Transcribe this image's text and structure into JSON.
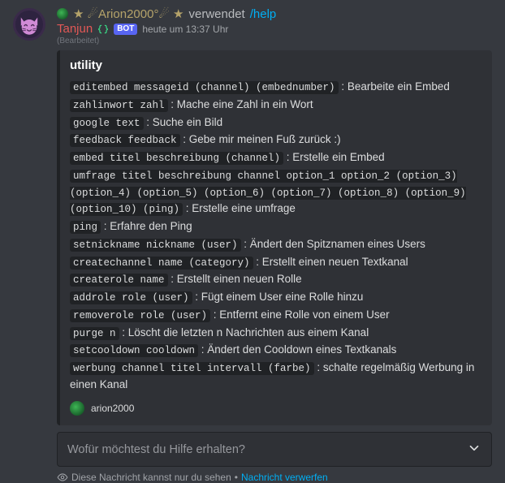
{
  "top_user": {
    "decorated_name": "★ ☄︎Arion2000°☄︎ ★",
    "used_label": "verwendet",
    "command": "/help"
  },
  "bot": {
    "name": "Tanjun",
    "tag": "BOT",
    "timestamp": "heute um 13:37 Uhr",
    "edited": "(Bearbeitet)"
  },
  "embed": {
    "title": "utility",
    "commands": [
      {
        "sig": "editembed messageid (channel) (embednumber)",
        "desc": "Bearbeite ein Embed"
      },
      {
        "sig": "zahlinwort zahl",
        "desc": "Mache eine Zahl in ein Wort"
      },
      {
        "sig": "google text",
        "desc": "Suche ein Bild"
      },
      {
        "sig": "feedback feedback",
        "desc": "Gebe mir meinen Fuß zurück :)"
      },
      {
        "sig": "embed titel beschreibung (channel)",
        "desc": "Erstelle ein Embed"
      },
      {
        "sig": "umfrage titel beschreibung channel option_1 option_2 (option_3) (option_4) (option_5) (option_6) (option_7) (option_8) (option_9) (option_10) (ping)",
        "desc": "Erstelle eine umfrage"
      },
      {
        "sig": "ping",
        "desc": "Erfahre den Ping"
      },
      {
        "sig": "setnickname nickname (user)",
        "desc": "Ändert den Spitznamen eines Users"
      },
      {
        "sig": "createchannel name (category)",
        "desc": "Erstellt einen neuen Textkanal"
      },
      {
        "sig": "createrole name",
        "desc": "Erstellt einen neuen Rolle"
      },
      {
        "sig": "addrole role (user)",
        "desc": "Fügt einem User eine Rolle hinzu"
      },
      {
        "sig": "removerole role (user)",
        "desc": "Entfernt eine Rolle von einem User"
      },
      {
        "sig": "purge n",
        "desc": "Löscht die letzten n Nachrichten aus einem Kanal"
      },
      {
        "sig": "setcooldown cooldown",
        "desc": "Ändert den Cooldown eines Textkanals"
      },
      {
        "sig": "werbung channel titel intervall (farbe)",
        "desc": "schalte regelmäßig Werbung in einen Kanal"
      }
    ],
    "footer": "arion2000"
  },
  "select": {
    "placeholder": "Wofür möchtest du Hilfe erhalten?"
  },
  "ephemeral": {
    "text": "Diese Nachricht kannst nur du sehen",
    "dismiss": "Nachricht verwerfen"
  }
}
